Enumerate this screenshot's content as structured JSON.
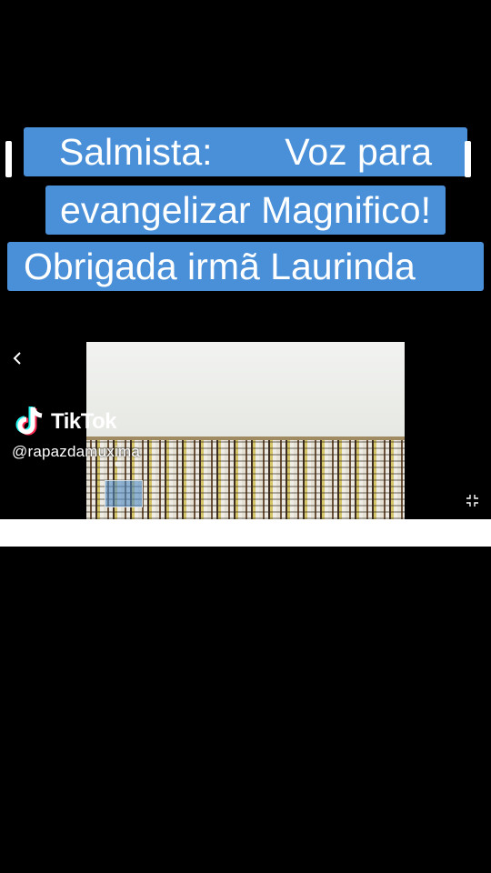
{
  "captions": {
    "line1": "Salmista:       Voz para",
    "line2": "evangelizar Magnifico!",
    "line3": "Obrigada irmã Laurinda"
  },
  "watermark": {
    "logo_text": "TikTok",
    "username": "@rapazdamuxima"
  },
  "colors": {
    "caption_background": "#4a90d9",
    "caption_text": "#ffffff",
    "page_background": "#000000"
  },
  "icons": {
    "back": "chevron-left-icon",
    "fullscreen": "exit-fullscreen-icon",
    "brand": "tiktok-logo-icon"
  }
}
